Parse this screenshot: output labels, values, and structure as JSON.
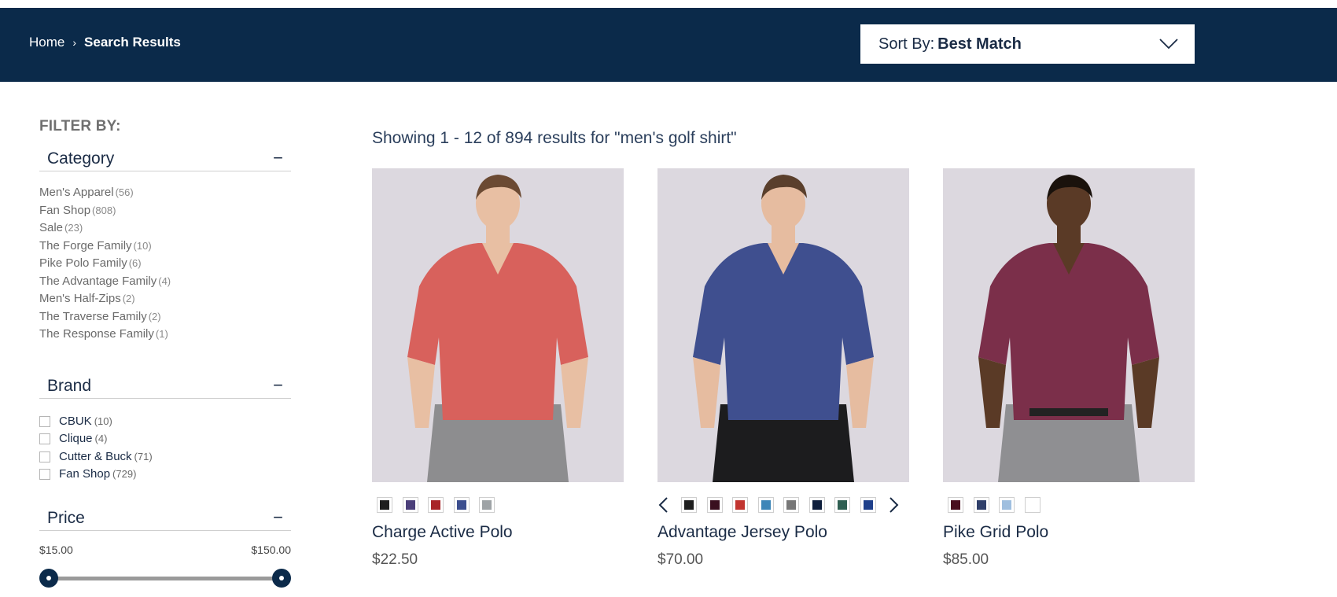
{
  "header": {
    "breadcrumb": [
      {
        "label": "Home"
      },
      {
        "label": "Search Results"
      }
    ],
    "breadcrumb_sep": "›",
    "sort": {
      "label": "Sort By:",
      "value": "Best Match"
    }
  },
  "sidebar": {
    "filter_title": "FILTER BY:",
    "category": {
      "title": "Category",
      "toggle": "−",
      "items": [
        {
          "label": "Men's Apparel",
          "count": "(56)"
        },
        {
          "label": "Fan Shop",
          "count": "(808)"
        },
        {
          "label": "Sale",
          "count": "(23)"
        },
        {
          "label": "The Forge Family",
          "count": "(10)"
        },
        {
          "label": "Pike Polo Family",
          "count": "(6)"
        },
        {
          "label": "The Advantage Family",
          "count": "(4)"
        },
        {
          "label": "Men's Half-Zips",
          "count": "(2)"
        },
        {
          "label": "The Traverse Family",
          "count": "(2)"
        },
        {
          "label": "The Response Family",
          "count": "(1)"
        }
      ]
    },
    "brand": {
      "title": "Brand",
      "toggle": "−",
      "items": [
        {
          "label": "CBUK",
          "count": "(10)"
        },
        {
          "label": "Clique",
          "count": "(4)"
        },
        {
          "label": "Cutter & Buck",
          "count": "(71)"
        },
        {
          "label": "Fan Shop",
          "count": "(729)"
        }
      ]
    },
    "price": {
      "title": "Price",
      "toggle": "−",
      "min": "$15.00",
      "max": "$150.00"
    }
  },
  "results": {
    "heading": "Showing 1 - 12 of 894 results for \"men's golf shirt\"",
    "products": [
      {
        "name": "Charge Active Polo",
        "price": "$22.50",
        "shirt_color": "#d8615c",
        "skin": "#e8bfa3",
        "hair": "#6b4a33",
        "pants": "#8d8d8f",
        "swatches": [
          "#1e1e1e",
          "#4b3f7a",
          "#a82428",
          "#3d4f8f",
          "#9ea3a6"
        ],
        "has_arrows": false
      },
      {
        "name": "Advantage Jersey Polo",
        "price": "$70.00",
        "shirt_color": "#3f4f8f",
        "skin": "#e6bca0",
        "hair": "#5a3f2c",
        "pants": "#1c1c1e",
        "swatches": [
          "#1f1f1f",
          "#3a0f1f",
          "#c23530",
          "#3e86b8",
          "#777777",
          "#0e1e3c",
          "#2f5f52",
          "#1e3f8a"
        ],
        "has_arrows": true
      },
      {
        "name": "Pike Grid Polo",
        "price": "$85.00",
        "shirt_color": "#7b2f4a",
        "skin": "#5a3a26",
        "hair": "#1a120c",
        "pants": "#8f8f92",
        "swatches": [
          "#4a0e1f",
          "#2f3f6a",
          "#9fbfdf",
          "#ffffff"
        ],
        "has_arrows": false
      }
    ]
  }
}
